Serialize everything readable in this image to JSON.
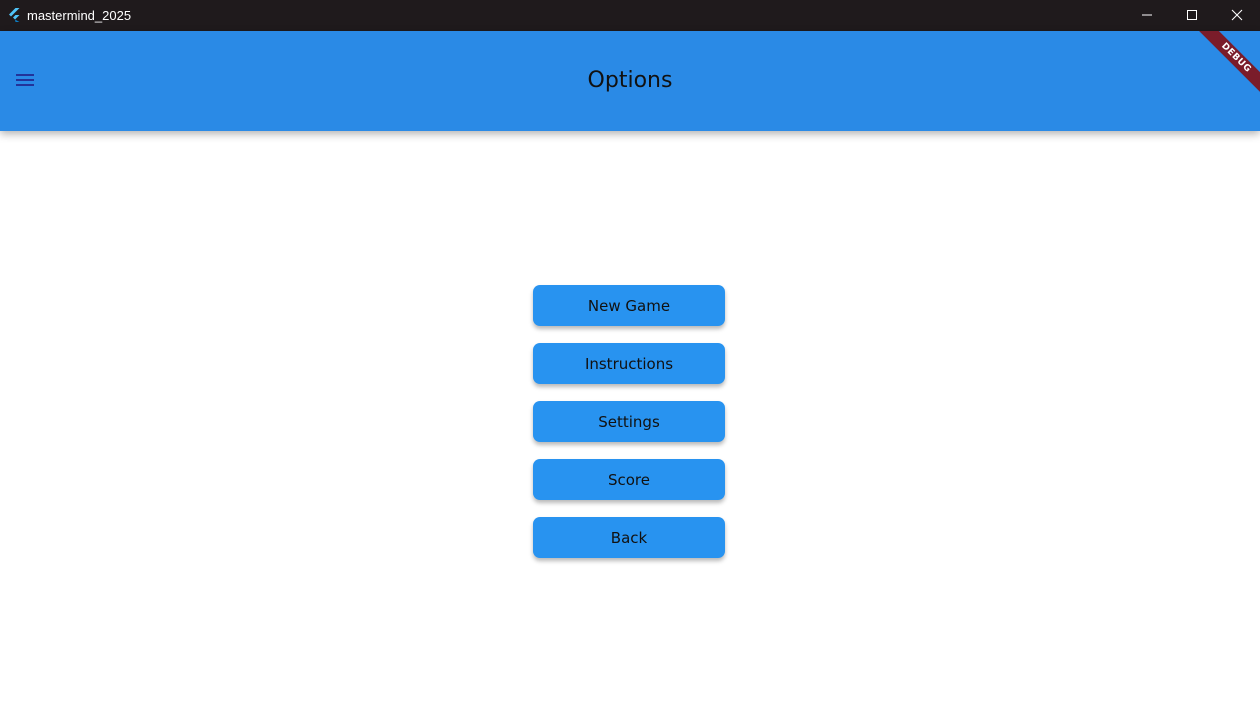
{
  "window": {
    "title": "mastermind_2025",
    "app_icon": "flutter-icon",
    "controls": {
      "minimize_icon": "minimize-icon",
      "maximize_icon": "maximize-icon",
      "close_icon": "close-icon"
    }
  },
  "appbar": {
    "title": "Options",
    "menu_icon": "hamburger-menu-icon",
    "debug_banner": "DEBUG",
    "background_color": "#2a8ae6"
  },
  "menu": {
    "buttons": [
      {
        "label": "New Game"
      },
      {
        "label": "Instructions"
      },
      {
        "label": "Settings"
      },
      {
        "label": "Score"
      },
      {
        "label": "Back"
      }
    ],
    "button_color": "#2893f0"
  }
}
